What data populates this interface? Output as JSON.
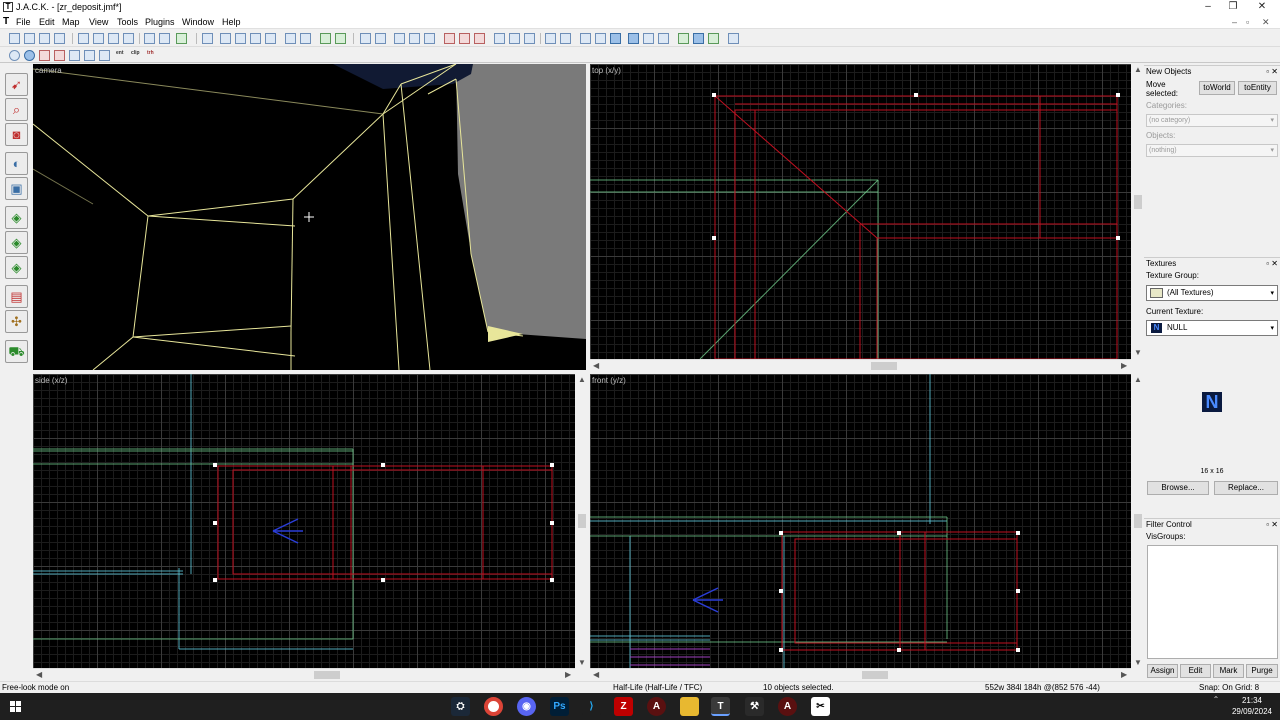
{
  "window": {
    "title": "J.A.C.K. - [zr_deposit.jmf*]",
    "minimize": "–",
    "maximize": "❐",
    "close": "✕"
  },
  "menu": [
    "File",
    "Edit",
    "Map",
    "View",
    "Tools",
    "Plugins",
    "Window",
    "Help"
  ],
  "viewports": {
    "camera": "camera",
    "top": "top (x/y)",
    "side": "side (x/z)",
    "front": "front (y/z)"
  },
  "toolbar2_labels": [
    "ent",
    "clip",
    "trh"
  ],
  "new_objects": {
    "header": "New Objects",
    "move_selected": "Move selected:",
    "to_world": "toWorld",
    "to_entity": "toEntity",
    "categories_label": "Categories:",
    "categories_value": "(no category)",
    "objects_label": "Objects:",
    "objects_value": "(nothing)"
  },
  "textures": {
    "header": "Textures",
    "group_label": "Texture Group:",
    "group_value": "(All Textures)",
    "current_label": "Current Texture:",
    "current_value": "NULL",
    "preview_letter": "N",
    "size": "16 x 16",
    "browse": "Browse...",
    "replace": "Replace..."
  },
  "filter_control": {
    "header": "Filter Control",
    "visgroups_label": "VisGroups:",
    "assign": "Assign",
    "edit": "Edit",
    "mark": "Mark",
    "purge": "Purge"
  },
  "status": {
    "mode": "Free-look mode on",
    "game": "Half-Life (Half-Life / TFC)",
    "selection": "10 objects selected.",
    "dimensions": "552w 384l 184h @(852 576 -44)",
    "snap": "Snap: On Grid: 8"
  },
  "taskbar": {
    "apps": [
      "steam",
      "chrome",
      "discord",
      "photoshop",
      "vscode",
      "filezilla",
      "app-a",
      "explorer",
      "jack",
      "app-hammer",
      "app-a2",
      "capcut"
    ],
    "time": "21:34",
    "date": "29/09/2024"
  },
  "colors": {
    "selected_brush": "#c01020",
    "camera_outline": "#e8e69a",
    "cyan_brush": "#5fc7d8",
    "green_brush": "#6fc98a",
    "entity_blue": "#2a3dd8"
  }
}
